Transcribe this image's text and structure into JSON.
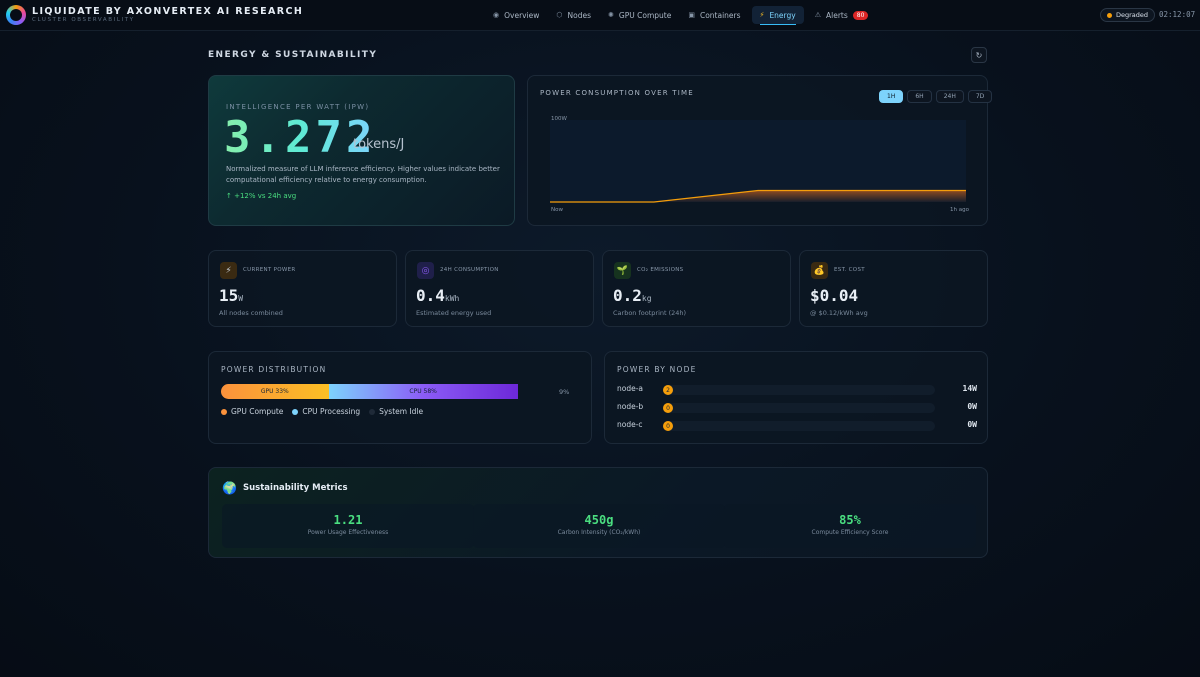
{
  "brand": {
    "title": "LIQUIDATE BY AXONVERTEX AI RESEARCH",
    "subtitle": "CLUSTER OBSERVABILITY"
  },
  "nav": {
    "overview": "Overview",
    "nodes": "Nodes",
    "gpu": "GPU Compute",
    "containers": "Containers",
    "energy": "Energy",
    "alerts": "Alerts",
    "alerts_count": "80"
  },
  "status": {
    "label": "Degraded",
    "color": "#f59e0b",
    "clock": "02:12:07"
  },
  "section": {
    "title": "ENERGY & SUSTAINABILITY",
    "refresh_icon": "refresh-icon"
  },
  "ipw": {
    "label": "INTELLIGENCE PER WATT (IPW)",
    "value": "3.272",
    "unit": "tokens/J",
    "description": "Normalized measure of LLM inference efficiency. Higher values indicate better computational efficiency relative to energy consumption.",
    "delta": "↑  +12% vs 24h avg"
  },
  "power_chart": {
    "title": "POWER CONSUMPTION OVER TIME",
    "ranges": [
      "1H",
      "6H",
      "24H",
      "7D"
    ],
    "active_range": "1H",
    "y_label": "100W",
    "x_start": "Now",
    "x_end": "1h ago"
  },
  "chart_data": {
    "type": "area",
    "title": "POWER CONSUMPTION OVER TIME",
    "ylim": [
      0,
      100
    ],
    "y_tick": "100W",
    "x_labels": [
      "Now",
      "1h ago"
    ],
    "x": [
      0,
      0.25,
      0.5,
      0.75,
      1
    ],
    "values": [
      0,
      0,
      14,
      14,
      14
    ]
  },
  "stats": [
    {
      "label": "CURRENT POWER",
      "value": "15",
      "unit": "W",
      "sub": "All nodes combined",
      "icon": "lightning-icon",
      "glyph": "⚡"
    },
    {
      "label": "24H CONSUMPTION",
      "value": "0.4",
      "unit": "kWh",
      "sub": "Estimated energy used",
      "icon": "target-icon",
      "glyph": "◎"
    },
    {
      "label": "CO₂ EMISSIONS",
      "value": "0.2",
      "unit": "kg",
      "sub": "Carbon footprint (24h)",
      "icon": "seedling-icon",
      "glyph": "🌱"
    },
    {
      "label": "EST. COST",
      "value": "$0.04",
      "unit": "",
      "sub": "@ $0.12/kWh avg",
      "icon": "money-bag-icon",
      "glyph": "💰"
    }
  ],
  "distribution": {
    "title": "POWER DISTRIBUTION",
    "gpu_label": "GPU 33%",
    "gpu_pct": 33,
    "cpu_label": "CPU 58%",
    "cpu_pct": 58,
    "idle_label": "9%",
    "legend": [
      "GPU Compute",
      "CPU Processing",
      "System Idle"
    ],
    "colors": {
      "gpu": "#fb923c",
      "cpu": "#7dd3fc",
      "idle": "#1f2a38"
    }
  },
  "nodes": {
    "title": "POWER BY NODE",
    "items": [
      {
        "name": "node-a",
        "badge": "2",
        "value": "14W"
      },
      {
        "name": "node-b",
        "badge": "0",
        "value": "0W"
      },
      {
        "name": "node-c",
        "badge": "0",
        "value": "0W"
      }
    ]
  },
  "sustainability": {
    "title": "Sustainability Metrics",
    "icon": "globe-icon",
    "metrics": [
      {
        "value": "1.21",
        "label": "Power Usage Effectiveness"
      },
      {
        "value": "450g",
        "label": "Carbon Intensity (CO₂/kWh)"
      },
      {
        "value": "85%",
        "label": "Compute Efficiency Score"
      }
    ]
  }
}
